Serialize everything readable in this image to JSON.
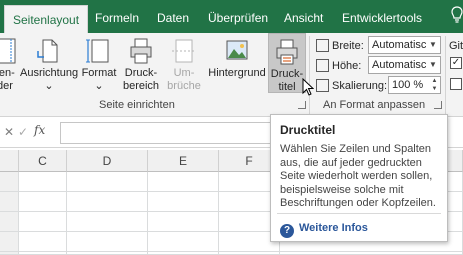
{
  "tabs": [
    {
      "label": "Seitenlayout",
      "active": true
    },
    {
      "label": "Formeln",
      "active": false
    },
    {
      "label": "Daten",
      "active": false
    },
    {
      "label": "Überprüfen",
      "active": false
    },
    {
      "label": "Ansicht",
      "active": false
    },
    {
      "label": "Entwicklertools",
      "active": false
    }
  ],
  "help_icon": "lightbulb-icon",
  "ribbon": {
    "seite_einrichten": {
      "buttons": [
        {
          "label_line1": "ren-",
          "label_line2": "der",
          "icon": "margins-icon"
        },
        {
          "label_line1": "Ausrichtung",
          "label_line2": "",
          "icon": "orientation-icon"
        },
        {
          "label_line1": "Format",
          "label_line2": "",
          "icon": "size-icon"
        },
        {
          "label_line1": "Druck-",
          "label_line2": "bereich",
          "icon": "print-area-icon"
        },
        {
          "label_line1": "Um-",
          "label_line2": "brüche",
          "icon": "breaks-icon",
          "disabled": true
        },
        {
          "label_line1": "Hintergrund",
          "label_line2": "",
          "icon": "background-icon"
        },
        {
          "label_line1": "Druck-",
          "label_line2": "titel",
          "icon": "print-titles-icon",
          "highlighted": true
        }
      ],
      "group_label": "Seite einrichten"
    },
    "an_format_anpassen": {
      "breite_label": "Breite:",
      "breite_value": "Automatiscl",
      "hoehe_label": "Höhe:",
      "hoehe_value": "Automatiscl",
      "skalierung_label": "Skalierung:",
      "skalierung_value": "100 %",
      "group_label": "An Format anpassen"
    },
    "blattoptionen": {
      "label": "Gitt"
    }
  },
  "formula_bar": {
    "fx": "fx"
  },
  "columns": [
    "C",
    "D",
    "E",
    "F"
  ],
  "tooltip": {
    "title": "Drucktitel",
    "description": "Wählen Sie Zeilen und Spalten aus, die auf jeder gedruckten Seite wiederholt werden sollen, beispielsweise solche mit Beschriftungen oder Kopfzeilen.",
    "link": "Weitere Infos",
    "link_icon": "help-circle-icon"
  },
  "colors": {
    "excel_green": "#217346",
    "ribbon_bg": "#f3f3f3",
    "link_blue": "#2b579a"
  }
}
